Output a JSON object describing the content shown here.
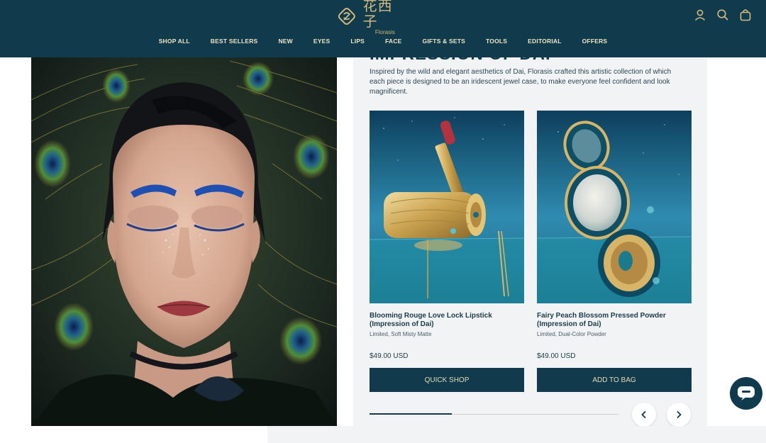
{
  "brand": {
    "name_cn": "花西子",
    "name_en": "Florasis"
  },
  "header": {
    "icons": [
      "user-icon",
      "search-icon",
      "bag-icon"
    ]
  },
  "nav": {
    "items": [
      "SHOP ALL",
      "BEST SELLERS",
      "NEW",
      "EYES",
      "LIPS",
      "FACE",
      "GIFTS & SETS",
      "TOOLS",
      "EDITORIAL",
      "OFFERS"
    ]
  },
  "collection": {
    "title": "IMPRESSION OF DAI",
    "description": "Inspired by the wild and elegant aesthetics of Dai, Florasis crafted this artistic collection of which each piece is designed to be an iridescent jewel case, to make everyone feel confident and look magnificent."
  },
  "products": [
    {
      "name": "Blooming Rouge Love Lock Lipstick (Impression of Dai)",
      "subtitle": "Limited, Soft Misty Matte",
      "price": "$49.00 USD",
      "button": "QUICK SHOP"
    },
    {
      "name": "Fairy Peach Blossom Pressed Powder (Impression of Dai)",
      "subtitle": "Limited, Dual-Color Powder",
      "price": "$49.00 USD",
      "button": "ADD TO BAG"
    }
  ],
  "carousel": {
    "progress": 0.33,
    "prev_icon": "chevron-left-icon",
    "next_icon": "chevron-right-icon"
  },
  "chat": {
    "icon": "chat-icon"
  },
  "colors": {
    "header_bg": "#0f3b4d",
    "accent_gold": "#d6b97c",
    "panel_bg": "#f2f3f5"
  }
}
